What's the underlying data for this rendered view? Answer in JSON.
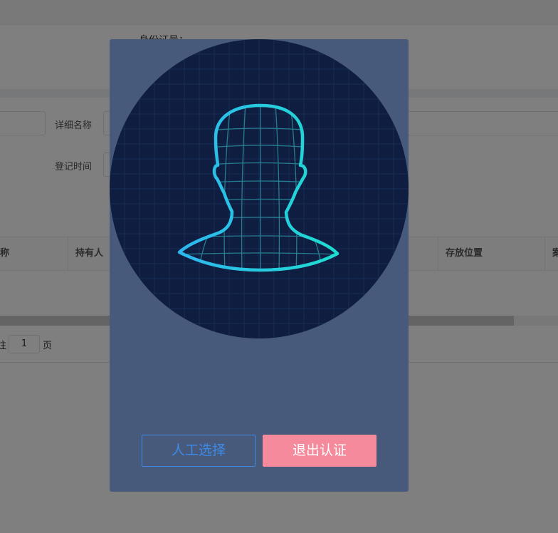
{
  "background": {
    "info_label": "身份证号：",
    "filter": {
      "detail_name_label": "详细名称",
      "register_time_label": "登记时间"
    },
    "table": {
      "columns": [
        "称",
        "持有人",
        "存放位置",
        "案"
      ]
    },
    "pager": {
      "prefix": "往",
      "page_value": "1",
      "suffix": "页"
    }
  },
  "modal": {
    "face_icon": "face-scan-icon",
    "buttons": {
      "manual_select": "人工选择",
      "exit_auth": "退出认证"
    }
  },
  "colors": {
    "modal_bg": "#475a7b",
    "circle_bg": "#0e1d40",
    "face_outline": "#22d3d8",
    "manual_button": "#3d8ae8",
    "exit_button": "#f58a9c"
  }
}
